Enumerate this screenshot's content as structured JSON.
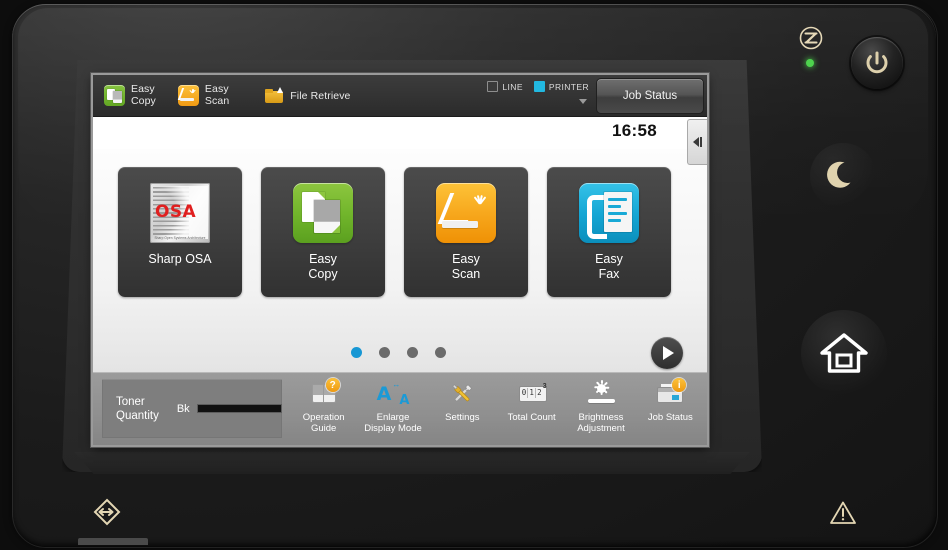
{
  "device": {
    "name": "sharp-mfp-operation-panel",
    "hardware": {
      "power_indicator_icon": "power-lightning-icon",
      "power_led": "green-status-led",
      "power_button": "power-button",
      "power_save_button": "crescent-moon-power-save-button",
      "home_button": "home-button",
      "nfc_icon": "data-transfer-diamond-icon",
      "warning_icon": "warning-triangle-icon"
    }
  },
  "screen": {
    "topbar": {
      "shortcuts": [
        {
          "icon": "easy-copy-icon",
          "line1": "Easy",
          "line2": "Copy"
        },
        {
          "icon": "easy-scan-icon",
          "line1": "Easy",
          "line2": "Scan"
        },
        {
          "icon": "file-retrieve-folder-icon",
          "line1": "File Retrieve",
          "line2": ""
        }
      ],
      "indicators": [
        {
          "label": "LINE",
          "state": "off",
          "color": "#3a3a3a"
        },
        {
          "label": "PRINTER",
          "state": "on",
          "color": "#22b8e0"
        }
      ],
      "job_status_button": "Job Status",
      "dropdown_caret_icon": "caret-down-icon"
    },
    "clockbar": {
      "time": "16:58",
      "collapse_tab_icon": "collapse-left-arrow-icon"
    },
    "home": {
      "tiles": [
        {
          "id": "sharp-osa",
          "icon": "sharp-osa-icon",
          "line1": "Sharp OSA",
          "line2": "",
          "osa_text": "OSA",
          "osa_caption": "Sharp Open Systems Architecture",
          "accent": "#e01f1f"
        },
        {
          "id": "easy-copy",
          "icon": "easy-copy-icon",
          "line1": "Easy",
          "line2": "Copy",
          "accent": "#72b62c"
        },
        {
          "id": "easy-scan",
          "icon": "easy-scan-icon",
          "line1": "Easy",
          "line2": "Scan",
          "accent": "#f7a71c"
        },
        {
          "id": "easy-fax",
          "icon": "easy-fax-icon",
          "line1": "Easy",
          "line2": "Fax",
          "accent": "#14a6d4"
        }
      ],
      "pager": {
        "page_count": 4,
        "current_page": 1,
        "next_button_icon": "next-page-arrow-icon"
      }
    },
    "funcbar": {
      "toner": {
        "line1": "Toner",
        "line2": "Quantity",
        "color_label": "Bk",
        "level_percent": 100
      },
      "functions": [
        {
          "id": "operation-guide",
          "icon": "operation-guide-icon",
          "line1": "Operation",
          "line2": "Guide",
          "badge": "?"
        },
        {
          "id": "enlarge-display-mode",
          "icon": "enlarge-display-mode-icon",
          "line1": "Enlarge",
          "line2": "Display Mode",
          "glyph_big": "A",
          "glyph_small": "A"
        },
        {
          "id": "settings",
          "icon": "settings-tools-icon",
          "line1": "Settings",
          "line2": ""
        },
        {
          "id": "total-count",
          "icon": "total-count-icon",
          "line1": "Total Count",
          "line2": "",
          "digits": [
            "0",
            "1",
            "2"
          ],
          "superscript": "3"
        },
        {
          "id": "brightness-adjustment",
          "icon": "brightness-sun-icon",
          "line1": "Brightness",
          "line2": "Adjustment"
        },
        {
          "id": "job-status",
          "icon": "job-status-printer-icon",
          "line1": "Job Status",
          "line2": "",
          "badge": "i"
        }
      ]
    }
  }
}
